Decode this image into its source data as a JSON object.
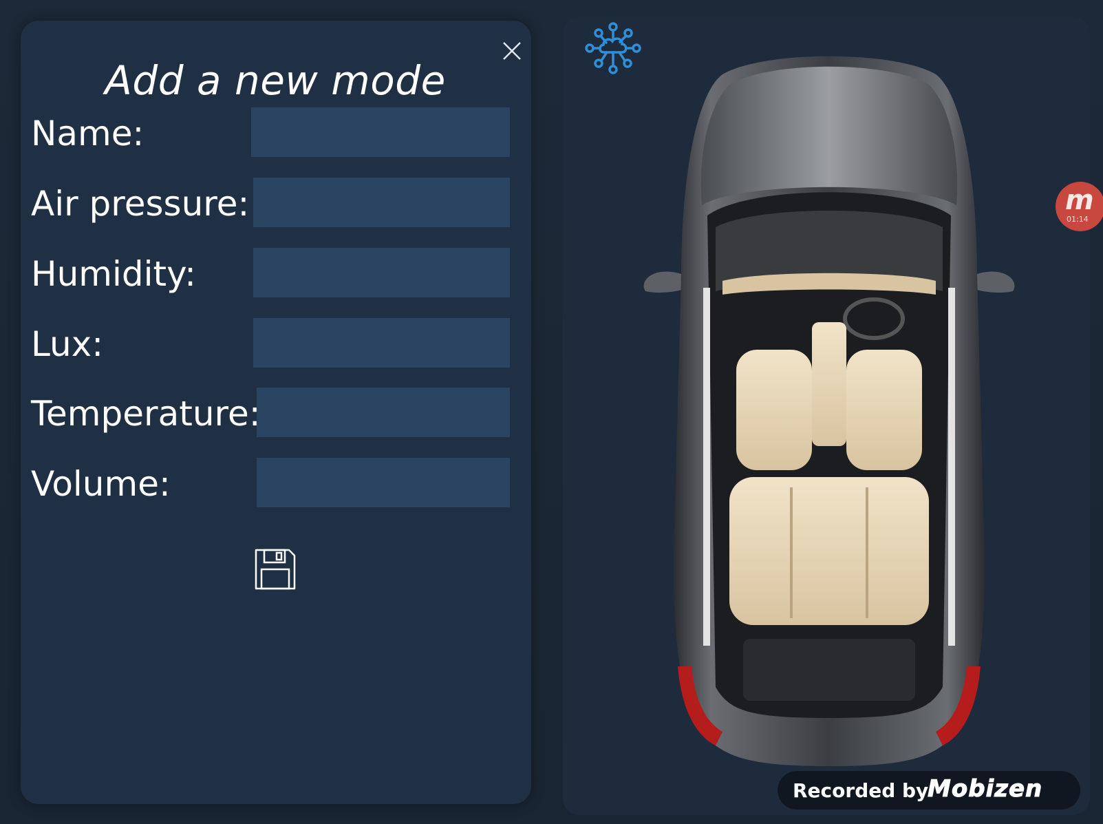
{
  "dialog": {
    "title": "Add a new mode",
    "close_icon": "close-icon",
    "fields": [
      {
        "label": "Name:",
        "value": "",
        "placeholder": ""
      },
      {
        "label": "Air pressure:",
        "value": "",
        "placeholder": ""
      },
      {
        "label": "Humidity:",
        "value": "",
        "placeholder": ""
      },
      {
        "label": "Lux:",
        "value": "",
        "placeholder": ""
      },
      {
        "label": "Temperature:",
        "value": "",
        "placeholder": ""
      },
      {
        "label": "Volume:",
        "value": "",
        "placeholder": ""
      }
    ],
    "save_icon": "floppy-disk-icon"
  },
  "car_panel": {
    "network_icon": "cloud-network-icon",
    "car_image": "car-top-view"
  },
  "overlay": {
    "recorder_logo": "m",
    "recorder_time": "01:14",
    "watermark_text": "Recorded by",
    "watermark_brand": "Mobizen"
  },
  "colors": {
    "background": "#1b2634",
    "dialog_bg": "#1f3044",
    "input_bg": "#2a4461",
    "accent_blue": "#2f8fd8",
    "recorder_red": "#c8483f"
  }
}
